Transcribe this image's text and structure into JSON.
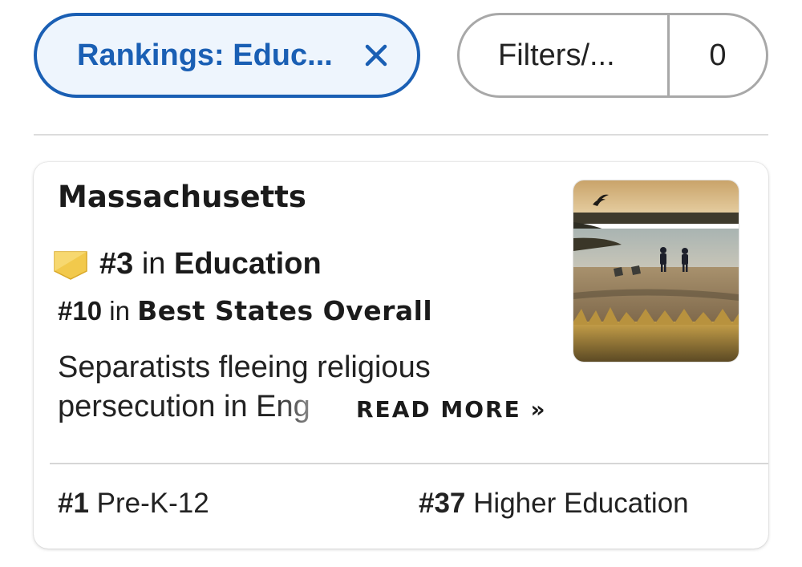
{
  "filters": {
    "rankings_chip_label": "Rankings: Educ...",
    "filters_chip_label": "Filters/...",
    "filters_count": "0",
    "accent_color": "#1a5fb4"
  },
  "card": {
    "state_name": "Massachusetts",
    "primary_rank": {
      "number": "#3",
      "connector": "in",
      "category": "Education",
      "badge_color": "#f2c94c"
    },
    "secondary_rank": {
      "number": "#10",
      "connector": "in",
      "category": "Best States Overall"
    },
    "blurb_line1": "Separatists fleeing religious",
    "blurb_line2": "persecution in Eng",
    "read_more": "READ MORE »",
    "sub_ranks": [
      {
        "number": "#1",
        "label": "Pre-K-12"
      },
      {
        "number": "#37",
        "label": "Higher Education"
      }
    ]
  }
}
